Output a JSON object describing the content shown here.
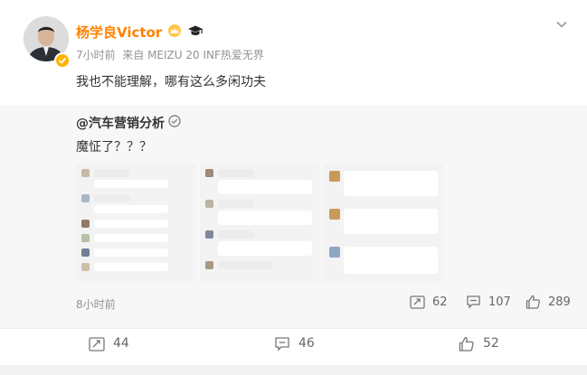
{
  "post": {
    "author": "杨学良Victor",
    "meta": "7小时前  来自 MEIZU 20 INF热爱无界",
    "text": "我也不能理解，哪有这么多闲功夫"
  },
  "retweet": {
    "author": "@汽车营销分析",
    "text": "魔怔了？？？",
    "time": "8小时前",
    "stats": {
      "reposts": "62",
      "comments": "107",
      "likes": "289"
    }
  },
  "actions": {
    "reposts": "44",
    "comments": "46",
    "likes": "52"
  },
  "icons": {
    "crown": "crown-icon",
    "grad_cap": "graduation-cap-icon",
    "verified": "verified-badge-icon",
    "dismiss": "chevron-down-icon",
    "repost": "repost-icon",
    "comment": "comment-icon",
    "like": "thumbs-up-icon"
  },
  "colors": {
    "username": "#ff8200",
    "meta": "#939393",
    "retweet_bg": "#f7f7f7"
  }
}
